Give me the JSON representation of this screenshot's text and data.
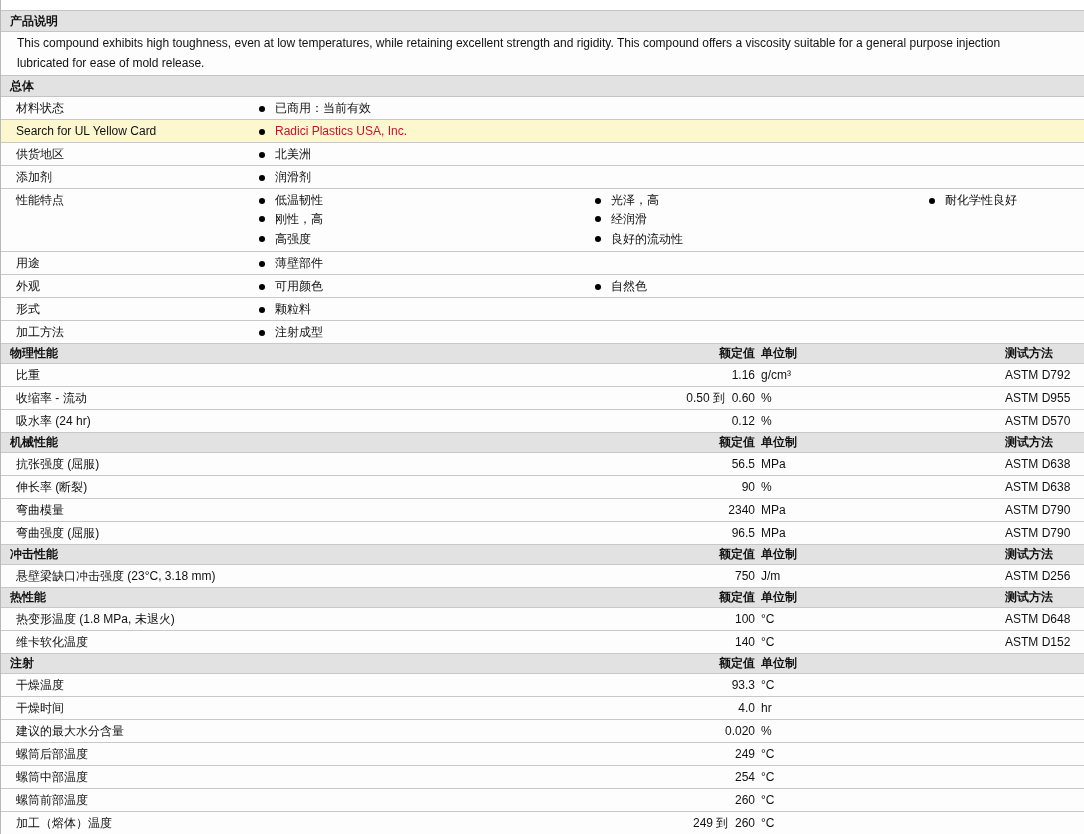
{
  "description": {
    "title": "产品说明",
    "lines": [
      "This compound exhibits high toughness, even at low temperatures, while retaining excellent strength and rigidity. This compound offers a viscosity suitable for a general purpose injection",
      "lubricated for ease of mold release."
    ]
  },
  "general": {
    "title": "总体",
    "rows": [
      {
        "label": "材料状态",
        "kind": "text",
        "highlighted": false,
        "columns": [
          [
            "已商用：当前有效"
          ]
        ]
      },
      {
        "label": "Search for UL Yellow Card",
        "kind": "link",
        "highlighted": true,
        "columns": [
          [
            "Radici Plastics USA, Inc."
          ]
        ]
      },
      {
        "label": "供货地区",
        "kind": "text",
        "highlighted": false,
        "columns": [
          [
            "北美洲"
          ]
        ]
      },
      {
        "label": "添加剂",
        "kind": "text",
        "highlighted": false,
        "columns": [
          [
            "润滑剂"
          ]
        ]
      },
      {
        "label": "性能特点",
        "kind": "text",
        "highlighted": false,
        "columns": [
          [
            "低温韧性",
            "刚性，高",
            "高强度"
          ],
          [
            "光泽，高",
            "经润滑",
            "良好的流动性"
          ],
          [
            "耐化学性良好"
          ]
        ]
      },
      {
        "label": "用途",
        "kind": "text",
        "highlighted": false,
        "columns": [
          [
            "薄壁部件"
          ]
        ]
      },
      {
        "label": "外观",
        "kind": "text",
        "highlighted": false,
        "columns": [
          [
            "可用颜色"
          ],
          [
            "自然色"
          ]
        ]
      },
      {
        "label": "形式",
        "kind": "text",
        "highlighted": false,
        "columns": [
          [
            "颗粒料"
          ]
        ]
      },
      {
        "label": "加工方法",
        "kind": "text",
        "highlighted": false,
        "columns": [
          [
            "注射成型"
          ]
        ]
      }
    ]
  },
  "sections": [
    {
      "title": "物理性能",
      "value_header": "额定值",
      "unit_header": "单位制",
      "method_header": "测试方法",
      "rows": [
        {
          "name": "比重",
          "value": "1.16",
          "unit": "g/cm³",
          "method": "ASTM D792"
        },
        {
          "name": "收缩率  - 流动",
          "value": "0.50 到  0.60",
          "unit": "%",
          "method": "ASTM D955"
        },
        {
          "name": "吸水率  (24 hr)",
          "value": "0.12",
          "unit": "%",
          "method": "ASTM D570"
        }
      ]
    },
    {
      "title": "机械性能",
      "value_header": "额定值",
      "unit_header": "单位制",
      "method_header": "测试方法",
      "rows": [
        {
          "name": "抗张强度  (屈服)",
          "value": "56.5",
          "unit": "MPa",
          "method": "ASTM D638"
        },
        {
          "name": "伸长率  (断裂)",
          "value": "90",
          "unit": "%",
          "method": "ASTM D638"
        },
        {
          "name": "弯曲模量",
          "value": "2340",
          "unit": "MPa",
          "method": "ASTM D790"
        },
        {
          "name": "弯曲强度  (屈服)",
          "value": "96.5",
          "unit": "MPa",
          "method": "ASTM D790"
        }
      ]
    },
    {
      "title": "冲击性能",
      "value_header": "额定值",
      "unit_header": "单位制",
      "method_header": "测试方法",
      "rows": [
        {
          "name": "悬壁梁缺口冲击强度  (23°C, 3.18 mm)",
          "value": "750",
          "unit": "J/m",
          "method": "ASTM D256"
        }
      ]
    },
    {
      "title": "热性能",
      "value_header": "额定值",
      "unit_header": "单位制",
      "method_header": "测试方法",
      "rows": [
        {
          "name": "热变形温度  (1.8 MPa, 未退火)",
          "value": "100",
          "unit": "°C",
          "method": "ASTM D648"
        },
        {
          "name": "维卡软化温度",
          "value": "140",
          "unit": "°C",
          "method": "ASTM D152"
        }
      ]
    },
    {
      "title": "注射",
      "value_header": "额定值",
      "unit_header": "单位制",
      "rows": [
        {
          "name": "干燥温度",
          "value": "93.3",
          "unit": "°C"
        },
        {
          "name": "干燥时间",
          "value": "4.0",
          "unit": "hr"
        },
        {
          "name": "建议的最大水分含量",
          "value": "0.020",
          "unit": "%"
        },
        {
          "name": "螺筒后部温度",
          "value": "249",
          "unit": "°C"
        },
        {
          "name": "螺筒中部温度",
          "value": "254",
          "unit": "°C"
        },
        {
          "name": "螺筒前部温度",
          "value": "260",
          "unit": "°C"
        },
        {
          "name": "加工（熔体）温度",
          "value": "249 到  260",
          "unit": "°C"
        }
      ]
    }
  ]
}
